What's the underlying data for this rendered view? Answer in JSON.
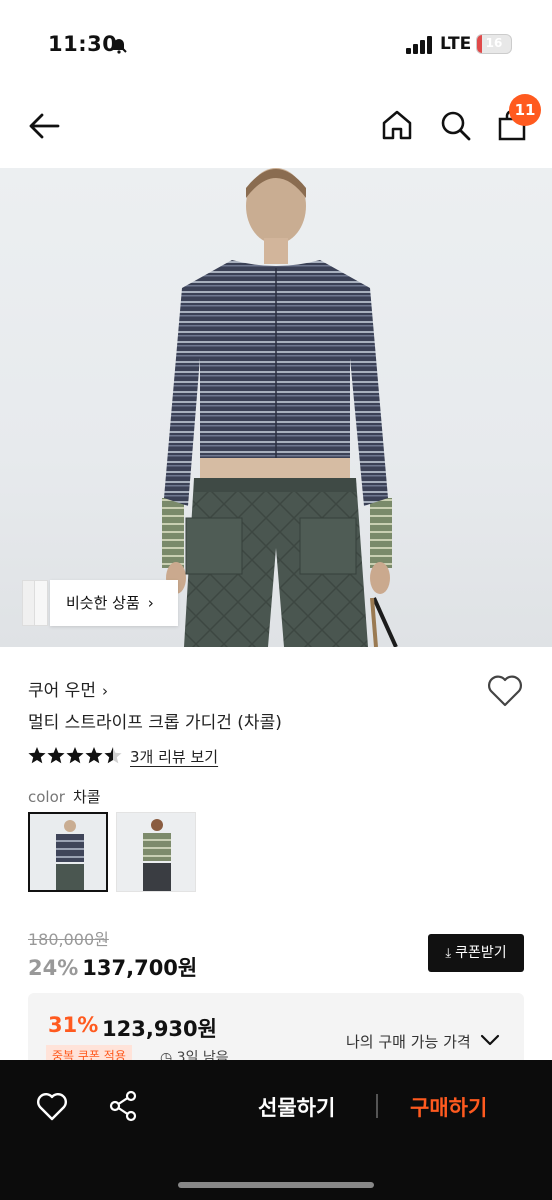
{
  "status": {
    "time": "11:30",
    "network": "LTE",
    "battery": "16",
    "battery_level": 0.16
  },
  "header": {
    "cart_count": "11"
  },
  "hero": {
    "similar_label": "비슷한 상품"
  },
  "product": {
    "brand": "쿠어 우먼",
    "title": "멀티 스트라이프 크롭 가디건 (차콜)",
    "rating": 4.5,
    "review_link": "3개 리뷰 보기",
    "color_label": "color",
    "color_value": "차콜"
  },
  "price": {
    "original": "180,000원",
    "discount_rate": "24%",
    "sale_price": "137,700원",
    "coupon_button": "쿠폰받기"
  },
  "best_price": {
    "rate": "31%",
    "price": "123,930원",
    "my_price_label": "나의 구매 가능 가격",
    "tag": "중복 쿠폰 적용",
    "days_left": "3일 남음"
  },
  "bottom": {
    "gift_label": "선물하기",
    "buy_label": "구매하기"
  },
  "colors": {
    "accent": "#ff5a1f",
    "dark": "#0c0c0c"
  }
}
